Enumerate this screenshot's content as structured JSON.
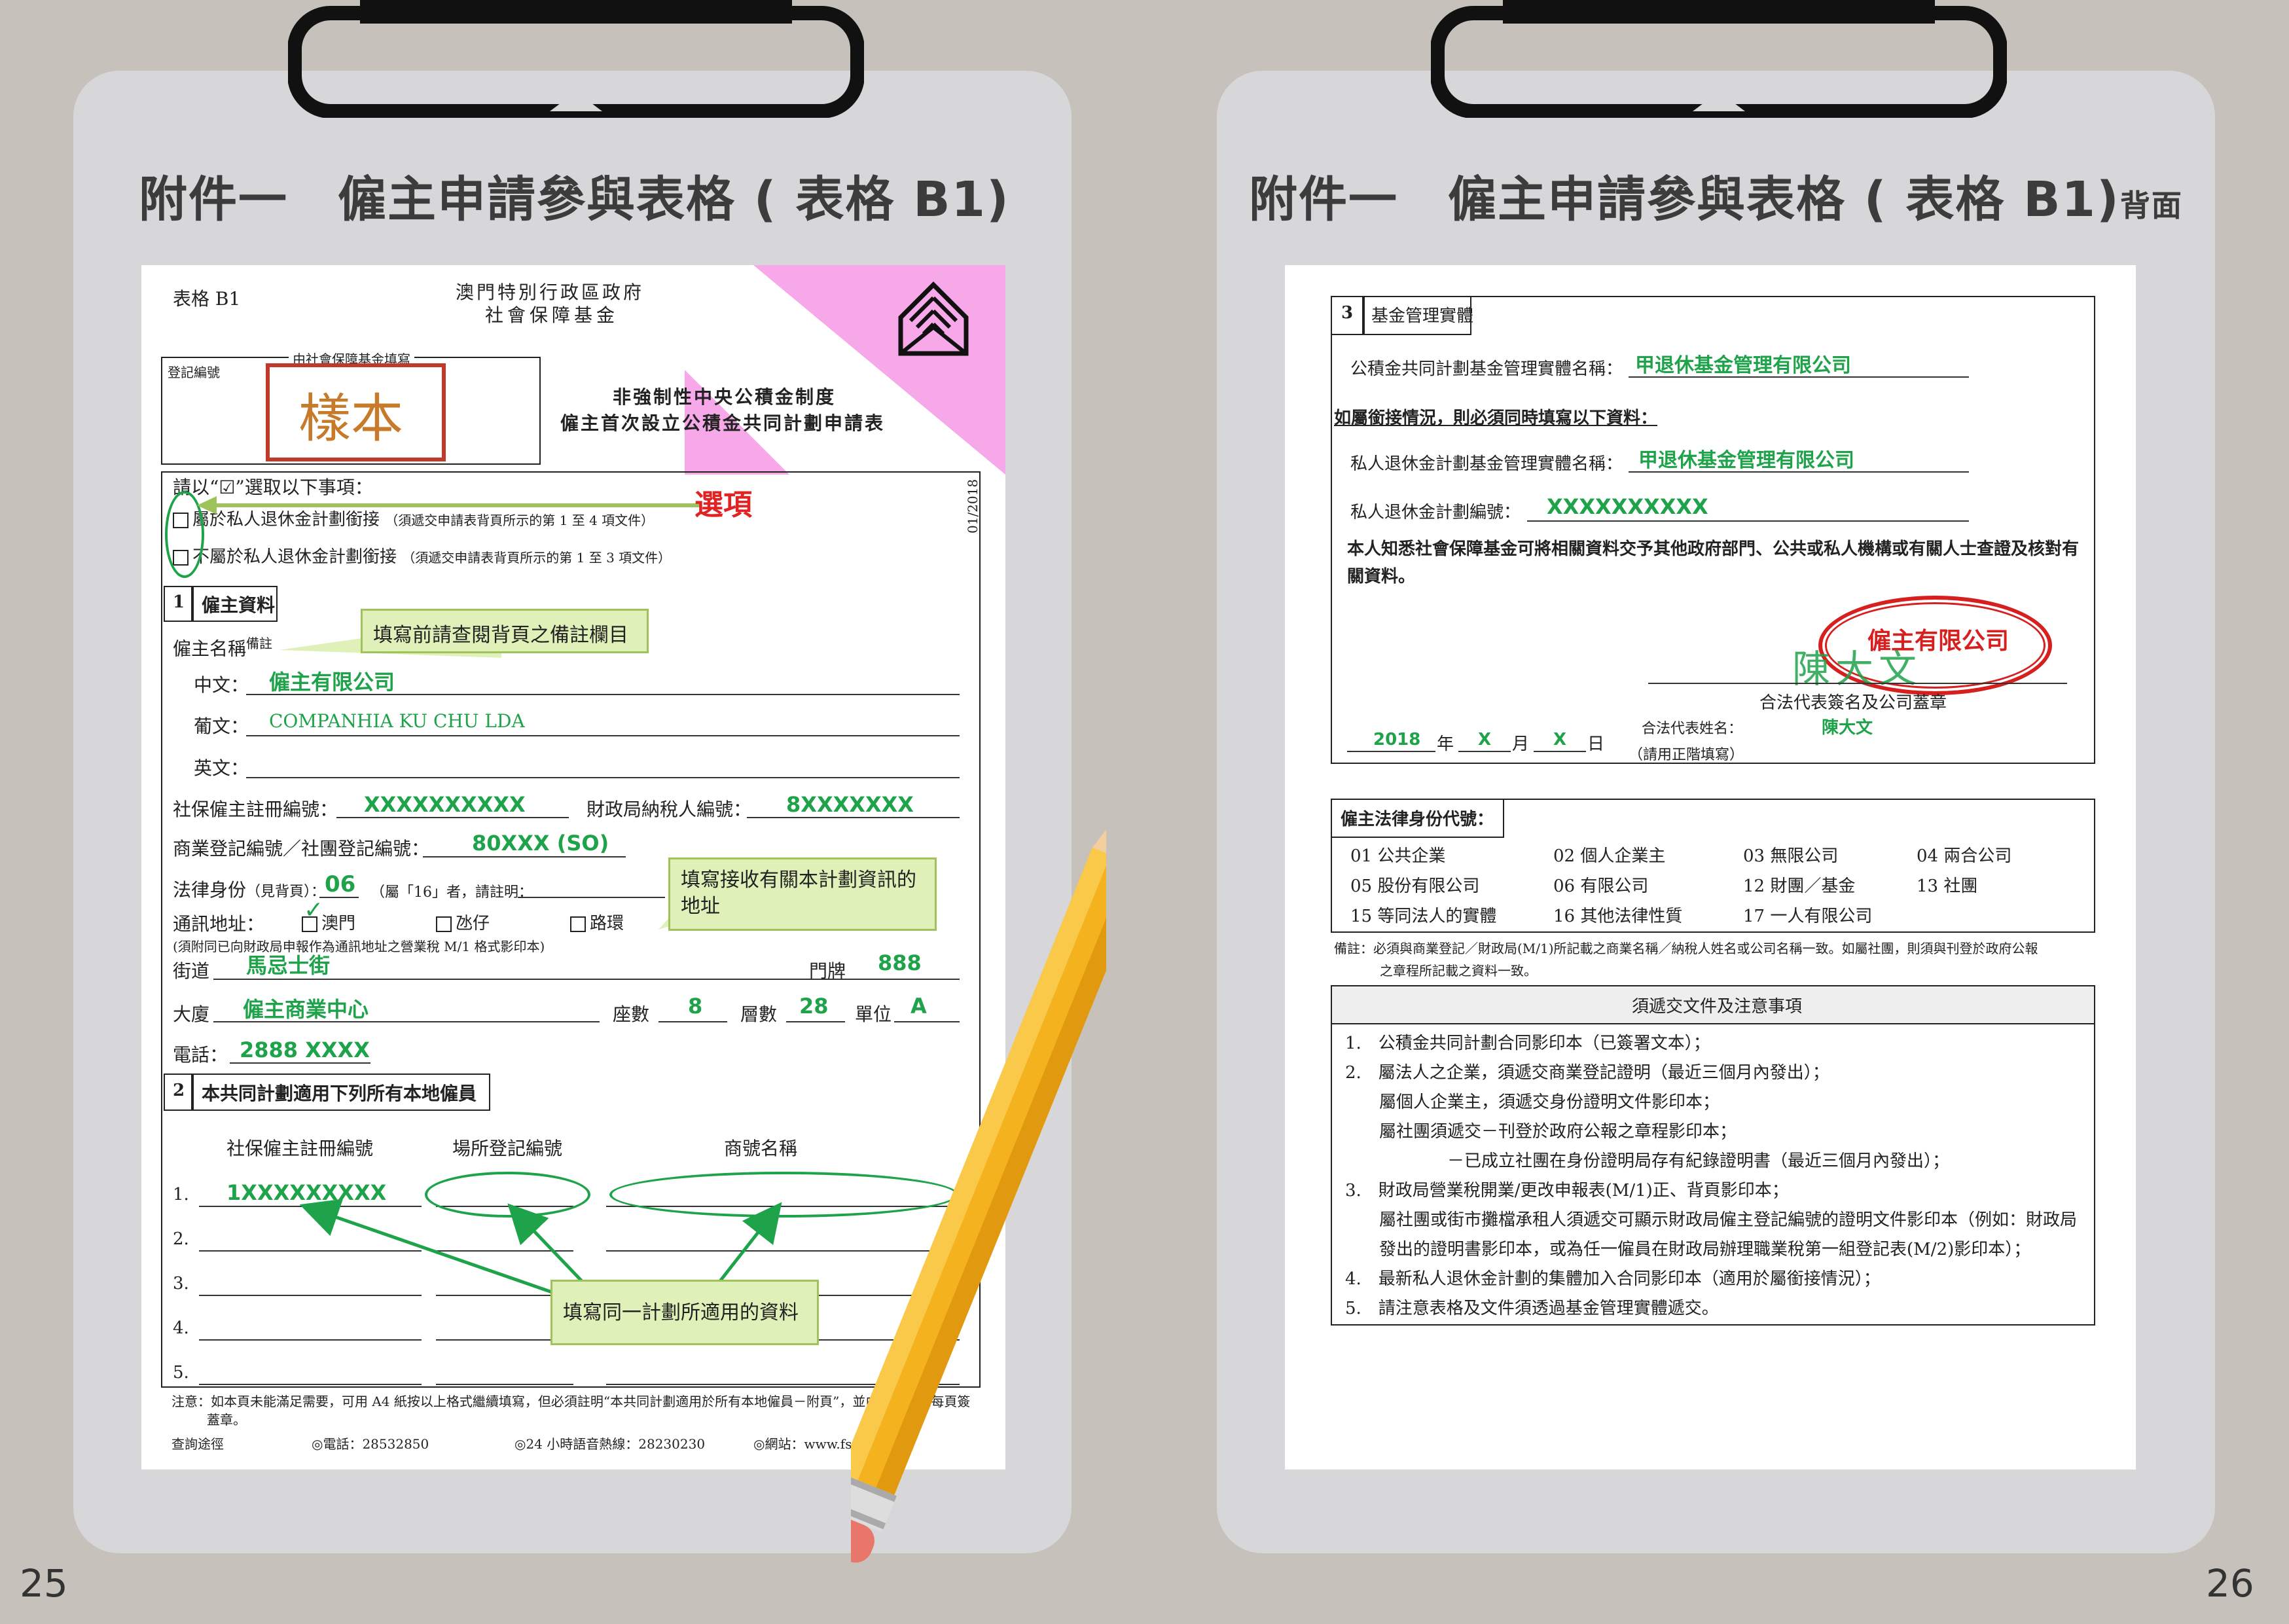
{
  "left": {
    "title": "附件一　僱主申請參與表格",
    "title_paren": "( 表格 B1)",
    "page_number": "25",
    "form": {
      "form_code": "表格 B1",
      "gov_line1": "澳門特別行政區政府",
      "gov_line2": "社會保障基金",
      "reg_no_label": "登記編號",
      "office_use": "由社會保障基金填寫",
      "sample_stamp": "樣本",
      "form_title1": "非強制性中央公積金制度",
      "form_title2": "僱主首次設立公積金共同計劃申請表",
      "instruction": "請以“☑”選取以下事項：",
      "option1": "屬於私人退休金計劃銜接",
      "option1_note": "（須遞交申請表背頁所示的第 1 至 4 項文件）",
      "option2": "不屬於私人退休金計劃銜接",
      "option2_note": "（須遞交申請表背頁所示的第 1 至 3 項文件）",
      "options_callout": "選項",
      "version": "01/2018",
      "s1_no": "1",
      "s1_title": "僱主資料",
      "name_label": "僱主名稱",
      "name_note": "備註",
      "name_callout": "填寫前請查閱背頁之備註欄目",
      "zh_label": "中文：",
      "zh_value": "僱主有限公司",
      "pt_label": "葡文：",
      "pt_value": "COMPANHIA KU CHU LDA",
      "en_label": "英文：",
      "ss_label": "社保僱主註冊編號：",
      "ss_value": "XXXXXXXXXX",
      "tax_label": "財政局納稅人編號：",
      "tax_value": "8XXXXXXX",
      "br_label": "商業登記編號／社團登記編號：",
      "br_value": "80XXX (SO)",
      "legal_label": "法律身份",
      "legal_label2": "（見背頁）：",
      "legal_value": "06",
      "legal_other": "（屬「16」者，請註明：",
      "legal_close": "）",
      "addr_callout": "填寫接收有關本計劃資訊的地址",
      "mail_label": "通訊地址：",
      "mail_opt1": "澳門",
      "mail_opt2": "氹仔",
      "mail_opt3": "路環",
      "mail_note": "(須附同已向財政局申報作為通訊地址之營業稅 M/1 格式影印本)",
      "street_label": "街道",
      "street_value": "馬忌士街",
      "door_label": "門牌",
      "door_value": "888",
      "bldg_label": "大廈",
      "bldg_value": "僱主商業中心",
      "block_label": "座數",
      "block_value": "8",
      "floor_label": "層數",
      "floor_value": "28",
      "unit_label": "單位",
      "unit_value": "A",
      "tel_label": "電話：",
      "tel_value": "2888 XXXX",
      "s2_no": "2",
      "s2_title": "本共同計劃適用下列所有本地僱員",
      "col1": "社保僱主註冊編號",
      "col2": "場所登記編號",
      "col3": "商號名稱",
      "rows": [
        "1.",
        "2.",
        "3.",
        "4.",
        "5."
      ],
      "row1_value": "1XXXXXXXXX",
      "table_callout": "填寫同一計劃所適用的資料",
      "footnote1": "注意：如本頁未能滿足需要，可用 A4 紙按以上格式繼續填寫，但必須註明“本共同計劃適用於所有本地僱員－附頁”，並由合法代表每頁簽",
      "footnote2": "蓋章。",
      "contact_label": "查詢途徑",
      "contact_tel": "◎電話：28532850",
      "contact_hotline": "◎24 小時語音熱線：28230230",
      "contact_web": "◎網站：www.fss.gov.mo"
    }
  },
  "right": {
    "title": "附件一　僱主申請參與表格",
    "title_paren": "( 表格 B1)",
    "title_suffix": "背面",
    "page_number": "26",
    "form": {
      "s3_no": "3",
      "s3_title": "基金管理實體",
      "mgr_label": "公積金共同計劃基金管理實體名稱：",
      "mgr_value": "甲退休基金管理有限公司",
      "connect_note": "如屬銜接情況，則必須同時填寫以下資料：",
      "priv_mgr_label": "私人退休金計劃基金管理實體名稱：",
      "priv_mgr_value": "甲退休基金管理有限公司",
      "priv_no_label": "私人退休金計劃編號：",
      "priv_no_value": "XXXXXXXXXX",
      "consent": "本人知悉社會保障基金可將相關資料交予其他政府部門、公共或私人機構或有關人士查證及核對有關資料。",
      "seal_text": "僱主有限公司",
      "signature": "陳大文",
      "sign_label": "合法代表簽名及公司蓋章",
      "rep_label": "合法代表姓名：",
      "rep_value": "陳大文",
      "rep_note": "（請用正階填寫）",
      "year_value": "2018",
      "year_label": "年",
      "month_value": "X",
      "month_label": "月",
      "day_value": "X",
      "day_label": "日",
      "legal_title": "僱主法律身份代號：",
      "legal_codes": [
        "01 公共企業",
        "02 個人企業主",
        "03 無限公司",
        "04 兩合公司",
        "05 股份有限公司",
        "06 有限公司",
        "12 財團／基金",
        "13 社團",
        "15 等同法人的實體",
        "16 其他法律性質",
        "17 一人有限公司"
      ],
      "remark1": "備註：必須與商業登記／財政局(M/1)所記載之商業名稱／納稅人姓名或公司名稱一致。如屬社團，則須與刊登於政府公報",
      "remark2": "之章程所記載之資料一致。",
      "docs_title": "須遞交文件及注意事項",
      "docs": [
        "1.　公積金共同計劃合同影印本（已簽署文本）；",
        "2.　屬法人之企業，須遞交商業登記證明（最近三個月內發出）；",
        "　　屬個人企業主，須遞交身份證明文件影印本；",
        "　　屬社團須遞交－刊登於政府公報之章程影印本；",
        "　　　　　　－已成立社團在身份證明局存有紀錄證明書（最近三個月內發出）；",
        "3.　財政局營業稅開業/更改申報表(M/1)正、背頁影印本；",
        "　　屬社團或街市攤檔承租人須遞交可顯示財政局僱主登記編號的證明文件影印本（例如：財政局",
        "　　發出的證明書影印本，或為任一僱員在財政局辦理職業稅第一組登記表(M/2)影印本）；",
        "4.　最新私人退休金計劃的集體加入合同影印本（適用於屬銜接情況）；",
        "5.　請注意表格及文件須透過基金管理實體遞交。"
      ]
    }
  },
  "colors": {
    "fill_green": "#1fa34a",
    "callout_red": "#e02424",
    "seal_red": "#d62020",
    "pink": "#f7a8e8"
  }
}
